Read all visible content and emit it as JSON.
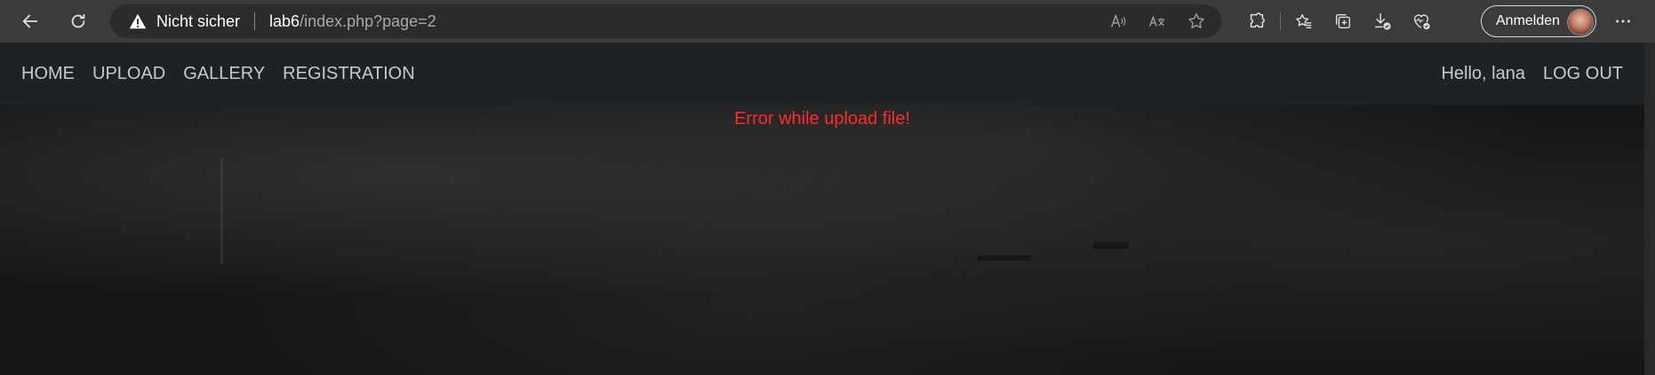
{
  "browser": {
    "security_label": "Nicht sicher",
    "url_host": "lab6",
    "url_path": "/index.php?page=2",
    "signin_label": "Anmelden"
  },
  "site_nav": {
    "links": [
      "HOME",
      "UPLOAD",
      "GALLERY",
      "REGISTRATION"
    ],
    "greeting": "Hello, lana",
    "logout_label": "LOG OUT"
  },
  "main": {
    "error_message": "Error while upload file!"
  },
  "colors": {
    "error": "#ff2a2a",
    "nav_background": "#1f2224",
    "browser_chrome": "#3b3b3b"
  },
  "icons": {
    "back": "back-arrow-icon",
    "refresh": "refresh-icon",
    "warning": "warning-icon",
    "read_aloud": "read-aloud-icon",
    "translate": "translate-icon",
    "favorite": "star-icon",
    "extensions": "puzzle-icon",
    "favorites": "favorites-icon",
    "collections": "collections-icon",
    "downloads": "download-icon",
    "health": "heart-pulse-icon",
    "more": "more-dots-icon"
  }
}
